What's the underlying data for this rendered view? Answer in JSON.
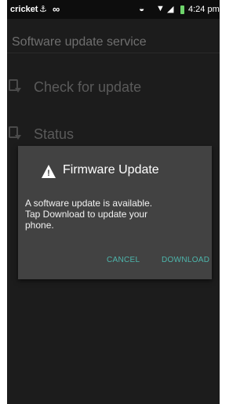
{
  "status_bar": {
    "carrier": "cricket",
    "time": "4:24 pm",
    "icons": [
      "usb-icon",
      "voicemail-icon",
      "sync-icon",
      "wifi-icon",
      "signal-icon",
      "battery-icon"
    ],
    "battery_color": "#6ed46b"
  },
  "app_bar": {
    "title": "Software update service"
  },
  "menu": {
    "items": [
      {
        "label": "Check for update",
        "icon": "update-file-icon"
      },
      {
        "label": "Status",
        "icon": "status-file-icon"
      }
    ]
  },
  "dialog": {
    "icon": "warning-icon",
    "title": "Firmware Update",
    "message": "A software update is available.\nTap Download to update your\nphone.",
    "buttons": {
      "cancel": "CANCEL",
      "download": "DOWNLOAD"
    },
    "accent_color": "#4db6ac"
  }
}
